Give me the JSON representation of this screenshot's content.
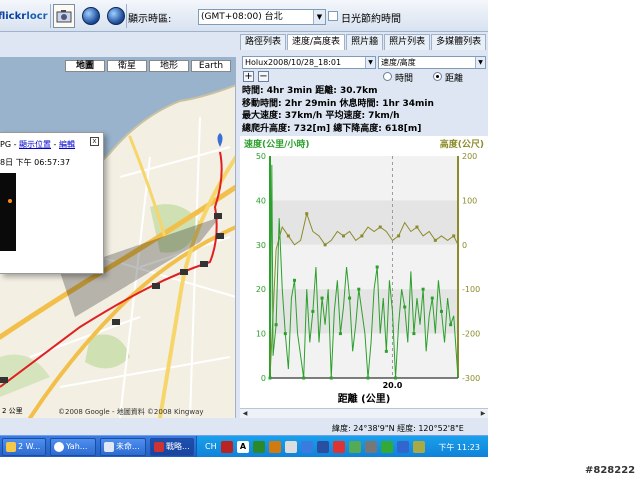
{
  "toolbar": {
    "flickr_label": "flickr",
    "locr_label": "locr",
    "timezone_label": "顯示時區:",
    "timezone_value": "(GMT+08:00) 台北",
    "dst_label": "日光節約時間"
  },
  "map": {
    "types": [
      "地圖",
      "衛星",
      "地形",
      "Earth"
    ],
    "active_type": "地圖",
    "attribution": "©2008 Google - 地圖資料 ©2008 Kingway",
    "scale_label": "2 公里",
    "infowindow": {
      "title_fragment": "PG",
      "show_location": "顯示位置",
      "edit": "編輯",
      "time_fragment": "8日 下午 06:57:37"
    }
  },
  "tabs": [
    "路徑列表",
    "速度/高度表",
    "照片牆",
    "照片列表",
    "多媒體列表"
  ],
  "active_tab": "速度/高度表",
  "track": {
    "name": "Holux2008/10/28_18:01",
    "mode": "速度/高度",
    "x_mode_options": [
      "時間",
      "距離"
    ],
    "x_mode_selected": "距離"
  },
  "stats": {
    "line1": "時間: 4hr 3min  距離: 30.7km",
    "line2": "移動時間: 2hr 29min  休息時間: 1hr 34min",
    "line3": "最大速度: 37km/h  平均速度: 7km/h",
    "line4": "總爬升高度: 732[m]  總下降高度: 618[m]"
  },
  "chart_data": {
    "type": "line",
    "ylabel": "速度(公里/小時)",
    "y2label": "高度(公尺)",
    "xlabel": "距離 (公里)",
    "ylim": [
      0,
      50
    ],
    "y2lim": [
      -300,
      200
    ],
    "yticks": [
      0,
      10,
      20,
      30,
      40,
      50
    ],
    "y2ticks": [
      -300,
      -200,
      -100,
      0,
      100,
      200
    ],
    "xticks": [
      20.0
    ],
    "xlim": [
      0,
      30.7
    ],
    "series": [
      {
        "axis": "right",
        "color": "#8b8b2a",
        "x": [
          0.0,
          1.0,
          2.0,
          3.0,
          4.0,
          5.0,
          6.0,
          7.0,
          8.0,
          9.0,
          10.0,
          11.0,
          12.0,
          13.0,
          14.0,
          15.0,
          16.0,
          17.0,
          18.0,
          19.0,
          20.0,
          21.0,
          22.0,
          23.0,
          24.0,
          25.0,
          26.0,
          27.0,
          28.0,
          29.0,
          30.0,
          30.7
        ],
        "values": [
          -300,
          -10,
          40,
          20,
          0,
          10,
          70,
          30,
          20,
          0,
          10,
          30,
          20,
          30,
          10,
          20,
          40,
          30,
          40,
          30,
          10,
          20,
          50,
          30,
          40,
          20,
          30,
          10,
          20,
          10,
          20,
          0
        ]
      },
      {
        "axis": "left",
        "color": "#2ca02c",
        "x": [
          0.0,
          0.3,
          0.5,
          1.0,
          1.5,
          2.0,
          2.5,
          3.0,
          3.5,
          4.0,
          4.5,
          5.0,
          5.5,
          6.0,
          6.5,
          7.0,
          7.5,
          8.0,
          8.5,
          9.0,
          9.5,
          10.0,
          10.5,
          11.0,
          11.5,
          12.0,
          12.5,
          13.0,
          13.5,
          14.0,
          14.5,
          15.0,
          15.5,
          16.0,
          16.5,
          17.0,
          17.5,
          18.0,
          18.5,
          19.0,
          19.5,
          20.0,
          20.5,
          21.0,
          21.5,
          22.0,
          22.5,
          23.0,
          23.5,
          24.0,
          24.5,
          25.0,
          25.5,
          26.0,
          26.5,
          27.0,
          27.5,
          28.0,
          28.5,
          29.0,
          29.5,
          30.0,
          30.7
        ],
        "values": [
          0,
          48,
          5,
          12,
          36,
          20,
          10,
          2,
          18,
          22,
          10,
          5,
          0,
          20,
          8,
          15,
          25,
          8,
          18,
          12,
          20,
          0,
          15,
          22,
          10,
          16,
          25,
          18,
          6,
          12,
          20,
          15,
          10,
          0,
          8,
          20,
          25,
          10,
          18,
          6,
          22,
          15,
          0,
          12,
          20,
          16,
          8,
          24,
          10,
          18,
          12,
          20,
          6,
          14,
          18,
          10,
          22,
          15,
          8,
          18,
          12,
          14,
          0
        ]
      }
    ]
  },
  "statusbar": {
    "coords": "緯度: 24°38'9\"N  經度: 120°52'8\"E"
  },
  "taskbar": {
    "tasks": [
      "2 W...",
      "Yah...",
      "未命...",
      "戰略..."
    ],
    "lang": "CH",
    "clock": "下午 11:23"
  },
  "watermark": "#828222"
}
